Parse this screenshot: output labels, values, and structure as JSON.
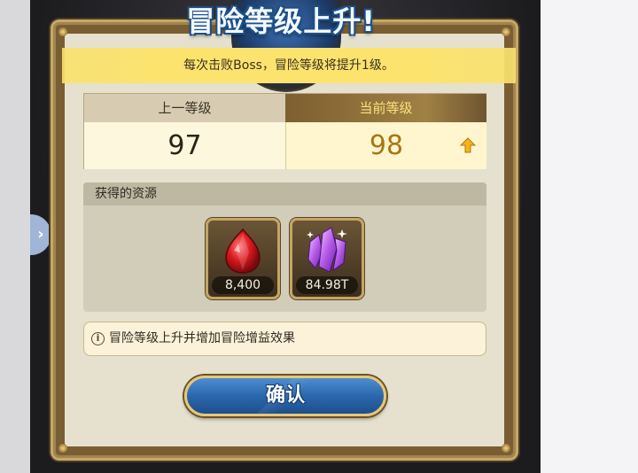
{
  "dialog": {
    "title": "冒险等级上升!",
    "banner": "每次击败Boss，冒险等级将提升1级。"
  },
  "level": {
    "prev_label": "上一等级",
    "prev_value": "97",
    "curr_label": "当前等级",
    "curr_value": "98",
    "arrow_icon": "up-arrow-icon"
  },
  "resources": {
    "header": "获得的资源",
    "items": [
      {
        "icon": "ruby-icon",
        "quantity": "8,400"
      },
      {
        "icon": "purple-crystal-icon",
        "quantity": "84.98T"
      }
    ]
  },
  "info": {
    "icon": "info-icon",
    "text": "冒险等级上升并增加冒险增益效果"
  },
  "confirm_button": {
    "label": "确认"
  },
  "side_tab": {
    "icon": "chevron-right-icon",
    "glyph": "›"
  },
  "colors": {
    "accent_gold": "#fbe27a",
    "button_blue": "#2b67ad",
    "level_up": "#a97612"
  }
}
